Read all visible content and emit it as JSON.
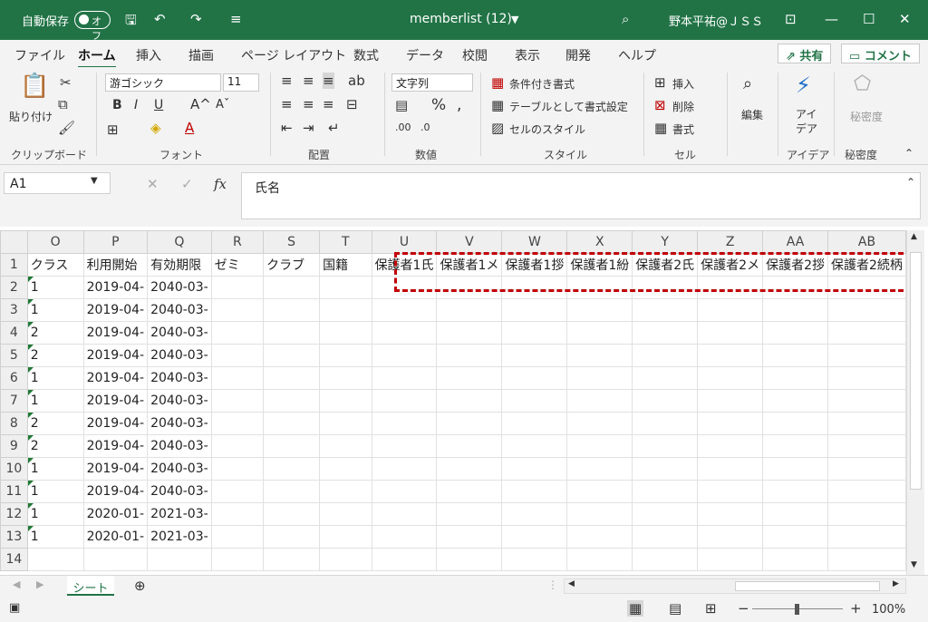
{
  "titlebar": {
    "autosave_label": "自動保存",
    "toggle_label": "オフ",
    "title": "memberlist (12)",
    "user": "野本平祐@ＪＳＳ",
    "accent": "#217346"
  },
  "tabs": [
    "ファイル",
    "ホーム",
    "挿入",
    "描画",
    "ページ レイアウト",
    "数式",
    "データ",
    "校閲",
    "表示",
    "開発",
    "ヘルプ"
  ],
  "active_tab": "ホーム",
  "share_label": "共有",
  "comment_label": "コメント",
  "ribbon": {
    "paste_label": "貼り付け",
    "font_name": "游ゴシック",
    "font_size": "11",
    "number_format": "文字列",
    "cond_format": "条件付き書式",
    "table_format": "テーブルとして書式設定",
    "cell_style": "セルのスタイル",
    "insert": "挿入",
    "delete": "削除",
    "format": "書式",
    "edit": "編集",
    "ideas": "アイ\nデア",
    "sensitivity": "秘密度",
    "groups": {
      "clipboard": "クリップボード",
      "font": "フォント",
      "alignment": "配置",
      "number": "数値",
      "style": "スタイル",
      "cells": "セル",
      "ideas": "アイデア",
      "sensitivity": "秘密度"
    }
  },
  "formula": {
    "name_box": "A1",
    "content": "氏名"
  },
  "columns": [
    "O",
    "P",
    "Q",
    "R",
    "S",
    "T",
    "U",
    "V",
    "W",
    "X",
    "Y",
    "Z",
    "AA",
    "AB"
  ],
  "header_row": [
    "クラス",
    "利用開始",
    "有効期限",
    "ゼミ",
    "クラブ",
    "国籍",
    "保護者1氏",
    "保護者1メ",
    "保護者1拶",
    "保護者1紛",
    "保護者2氏",
    "保護者2メ",
    "保護者2拶",
    "保護者2続柄"
  ],
  "rows": [
    {
      "n": "2",
      "cls": "1",
      "start": "2019-04-",
      "end": "2040-03-"
    },
    {
      "n": "3",
      "cls": "1",
      "start": "2019-04-",
      "end": "2040-03-"
    },
    {
      "n": "4",
      "cls": "2",
      "start": "2019-04-",
      "end": "2040-03-"
    },
    {
      "n": "5",
      "cls": "2",
      "start": "2019-04-",
      "end": "2040-03-"
    },
    {
      "n": "6",
      "cls": "1",
      "start": "2019-04-",
      "end": "2040-03-"
    },
    {
      "n": "7",
      "cls": "1",
      "start": "2019-04-",
      "end": "2040-03-"
    },
    {
      "n": "8",
      "cls": "2",
      "start": "2019-04-",
      "end": "2040-03-"
    },
    {
      "n": "9",
      "cls": "2",
      "start": "2019-04-",
      "end": "2040-03-"
    },
    {
      "n": "10",
      "cls": "1",
      "start": "2019-04-",
      "end": "2040-03-"
    },
    {
      "n": "11",
      "cls": "1",
      "start": "2019-04-",
      "end": "2040-03-"
    },
    {
      "n": "12",
      "cls": "1",
      "start": "2020-01-",
      "end": "2021-03-"
    },
    {
      "n": "13",
      "cls": "1",
      "start": "2020-01-",
      "end": "2021-03-"
    },
    {
      "n": "14",
      "cls": "",
      "start": "",
      "end": ""
    }
  ],
  "sheet_tab": "シート",
  "zoom": "100%"
}
